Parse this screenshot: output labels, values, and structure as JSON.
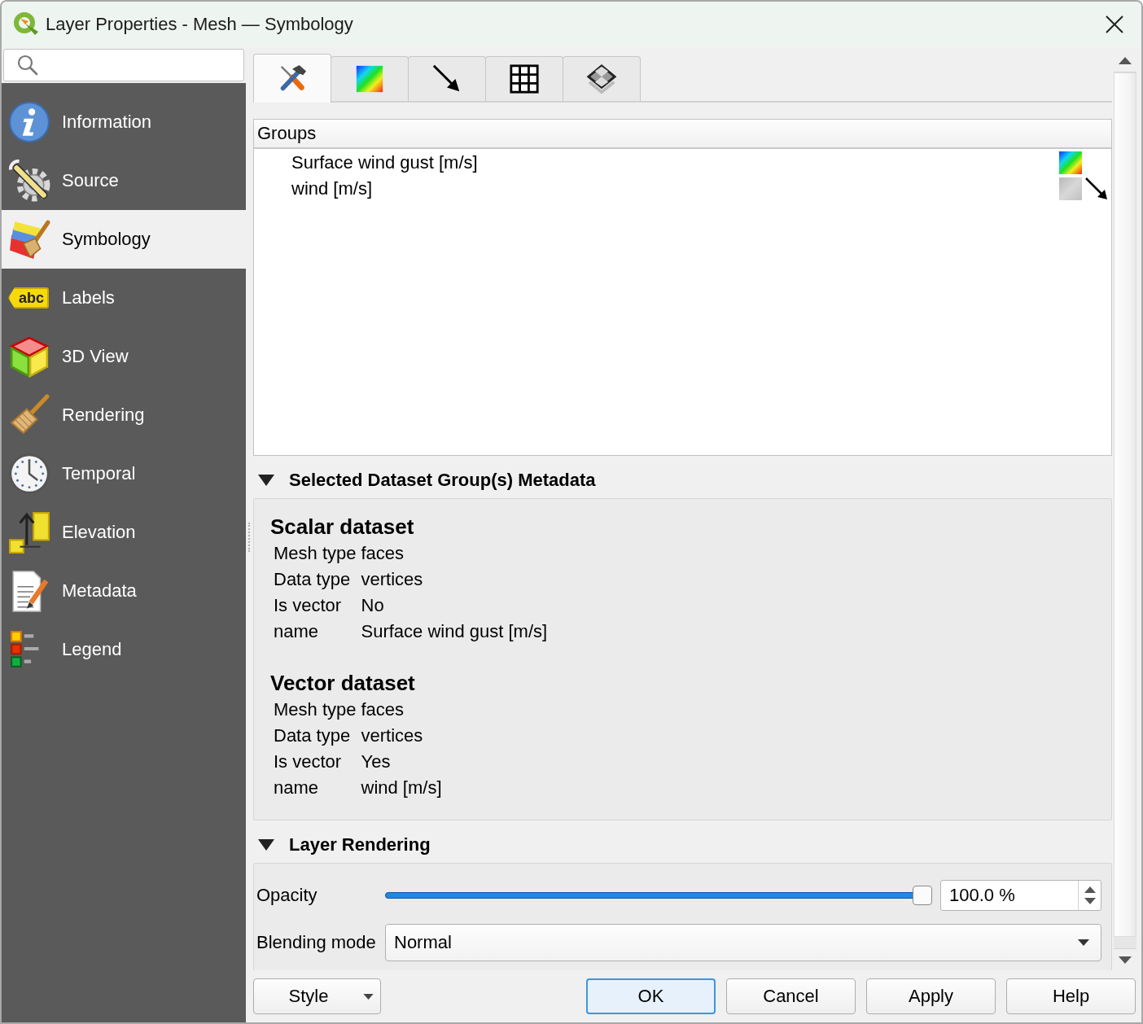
{
  "window": {
    "title": "Layer Properties - Mesh — Symbology"
  },
  "sidebar": {
    "items": [
      {
        "label": "Information",
        "selected": false
      },
      {
        "label": "Source",
        "selected": false
      },
      {
        "label": "Symbology",
        "selected": true
      },
      {
        "label": "Labels",
        "selected": false,
        "icon_text": "abc"
      },
      {
        "label": "3D View",
        "selected": false
      },
      {
        "label": "Rendering",
        "selected": false
      },
      {
        "label": "Temporal",
        "selected": false
      },
      {
        "label": "Elevation",
        "selected": false
      },
      {
        "label": "Metadata",
        "selected": false
      },
      {
        "label": "Legend",
        "selected": false
      }
    ]
  },
  "tabs": [
    {
      "selected": true
    },
    {
      "selected": false
    },
    {
      "selected": false
    },
    {
      "selected": false
    },
    {
      "selected": false
    }
  ],
  "groups_tree": {
    "header": "Groups",
    "rows": [
      {
        "label": "Surface wind gust [m/s]",
        "scalar_on": true,
        "vector_on": false
      },
      {
        "label": "wind [m/s]",
        "scalar_on": false,
        "vector_on": true
      }
    ]
  },
  "metadata_section": {
    "title": "Selected Dataset Group(s) Metadata",
    "expanded": true,
    "datasets": [
      {
        "heading": "Scalar dataset",
        "fields": [
          {
            "label": "Mesh type",
            "value": "faces"
          },
          {
            "label": "Data type",
            "value": "vertices"
          },
          {
            "label": "Is vector",
            "value": "No"
          },
          {
            "label": "name",
            "value": "Surface wind gust [m/s]"
          }
        ]
      },
      {
        "heading": "Vector dataset",
        "fields": [
          {
            "label": "Mesh type",
            "value": "faces"
          },
          {
            "label": "Data type",
            "value": "vertices"
          },
          {
            "label": "Is vector",
            "value": "Yes"
          },
          {
            "label": "name",
            "value": "wind [m/s]"
          }
        ]
      }
    ]
  },
  "rendering_section": {
    "title": "Layer Rendering",
    "expanded": true,
    "opacity": {
      "label": "Opacity",
      "level": 1,
      "value": "100.0 %"
    },
    "blending_mode": {
      "label": "Blending mode",
      "value": "Normal"
    }
  },
  "style_button": {
    "label": "Style"
  },
  "buttons": [
    {
      "label": "OK",
      "default": true
    },
    {
      "label": "Cancel",
      "default": false
    },
    {
      "label": "Apply",
      "default": false
    },
    {
      "label": "Help",
      "default": false
    }
  ]
}
